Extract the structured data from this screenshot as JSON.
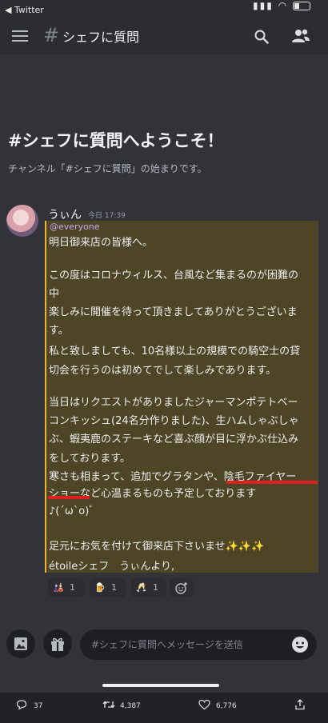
{
  "status_bar": {
    "back_label": "◀ Twitter"
  },
  "header": {
    "hash": "#",
    "channel_name": "シェフに質問"
  },
  "welcome": {
    "title": "#シェフに質問へようこそ！",
    "subtitle": "チャンネル「#シェフに質問」の始まりです。"
  },
  "message": {
    "author": "うぃん",
    "time": "今日 17:39",
    "mention": "@everyone",
    "lines": [
      "明日御来店の皆様へ。",
      "",
      "この度はコロナウィルス、台風など集まるのが困難の",
      "中",
      "楽しみに開催を待って頂きましてありがとうございま",
      "す。",
      "私と致しましても、10名様以上の規模での騎空士の貸",
      "切会を行うのは初めてでして楽しみであります。",
      "",
      "当日はリクエストがありましたジャーマンポテトベー",
      "コンキッシュ(24名分作りました)、生ハムしゃぶしゃ",
      "ぶ、蝦夷鹿のステーキなど喜ぶ顔が目に浮かぶ仕込み",
      "をしております。",
      "寒さも相まって、追加でグラタンや、陰毛ファイヤー",
      "ショーなど心温まるものも予定しております",
      "♪(´ω`o)ﾞ",
      "",
      "足元にお気を付けて御来店下さいませ✨✨✨",
      "étoileシェフ　うぃんより,"
    ]
  },
  "reactions": [
    {
      "icon": "🎎",
      "count": "1"
    },
    {
      "icon": "🍺",
      "count": "1"
    },
    {
      "icon": "🥂",
      "count": "1"
    }
  ],
  "composer": {
    "placeholder": "#シェフに質問へメッセージを送信"
  },
  "twitter_bar": {
    "replies": "37",
    "retweets": "4,387",
    "likes": "6,776"
  }
}
